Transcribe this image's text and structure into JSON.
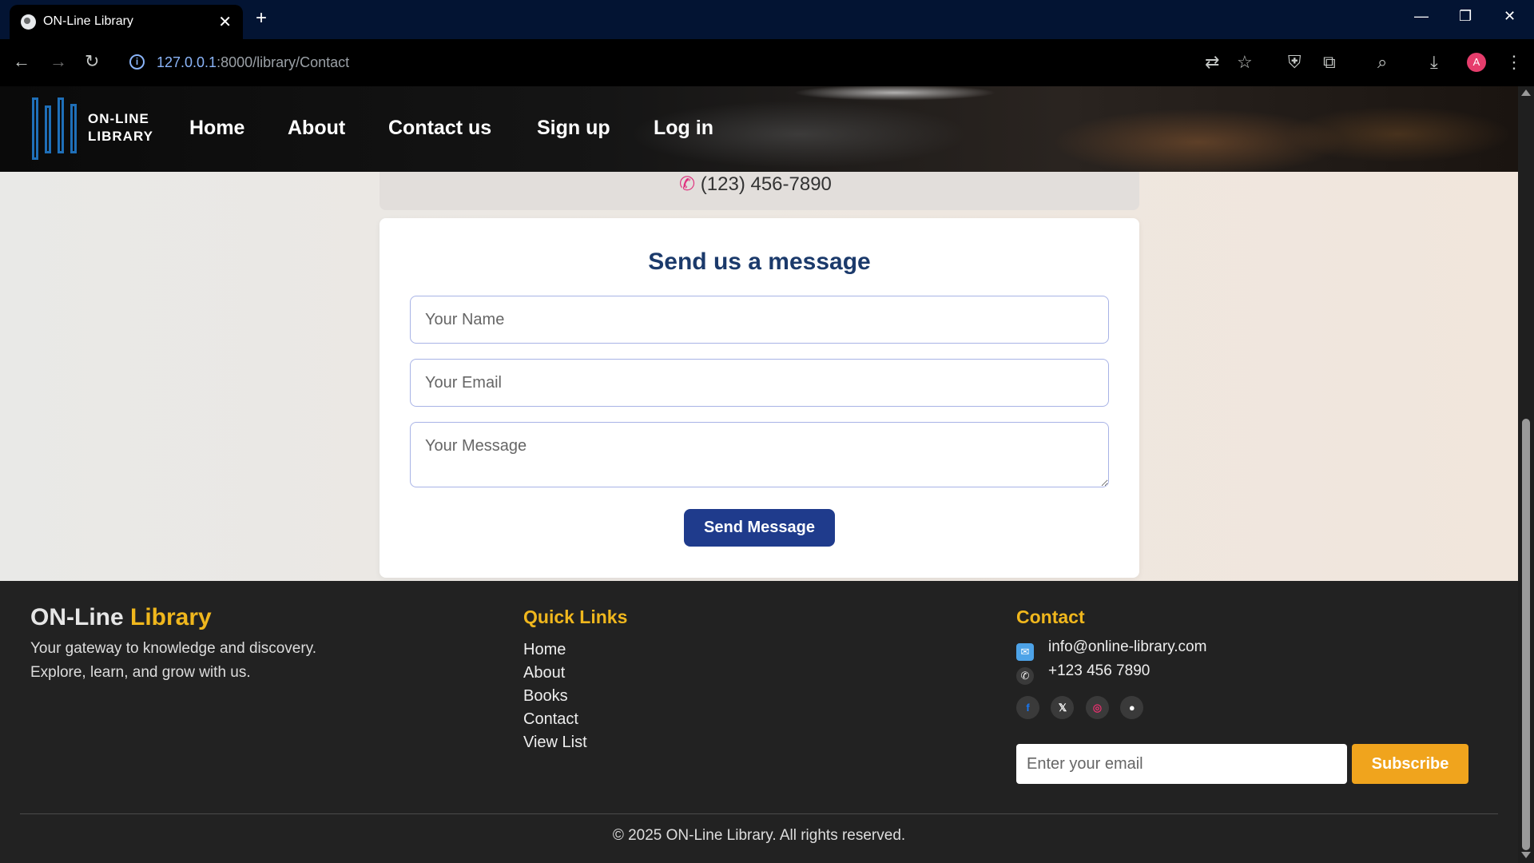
{
  "browser": {
    "tab_title": "ON-Line Library",
    "url_host": "127.0.0.1",
    "url_path": ":8000/library/Contact",
    "avatar_letter": "A"
  },
  "site": {
    "logo_line1": "ON-LINE",
    "logo_line2": "LIBRARY",
    "nav": [
      "Home",
      "About",
      "Contact us",
      "Sign up",
      "Log in"
    ]
  },
  "contact_info": {
    "phone": "(123) 456-7890"
  },
  "form": {
    "title": "Send us a message",
    "name_placeholder": "Your Name",
    "email_placeholder": "Your Email",
    "message_placeholder": "Your Message",
    "send_label": "Send Message"
  },
  "footer": {
    "brand_part1": "ON-Line",
    "brand_part2": "Library",
    "tagline1": "Your gateway to knowledge and discovery.",
    "tagline2": "Explore, learn, and grow with us.",
    "quick_links_title": "Quick Links",
    "quick_links": [
      "Home",
      "About",
      "Books",
      "Contact",
      "View List"
    ],
    "contact_title": "Contact",
    "email": "info@online-library.com",
    "phone": "+123 456 7890",
    "subscribe_placeholder": "Enter your email",
    "subscribe_label": "Subscribe",
    "copyright": "© 2025 ON-Line Library. All rights reserved."
  },
  "colors": {
    "accent_yellow": "#f0b71d",
    "primary_blue": "#1f3b8c",
    "title_blue": "#1b3a6b"
  }
}
